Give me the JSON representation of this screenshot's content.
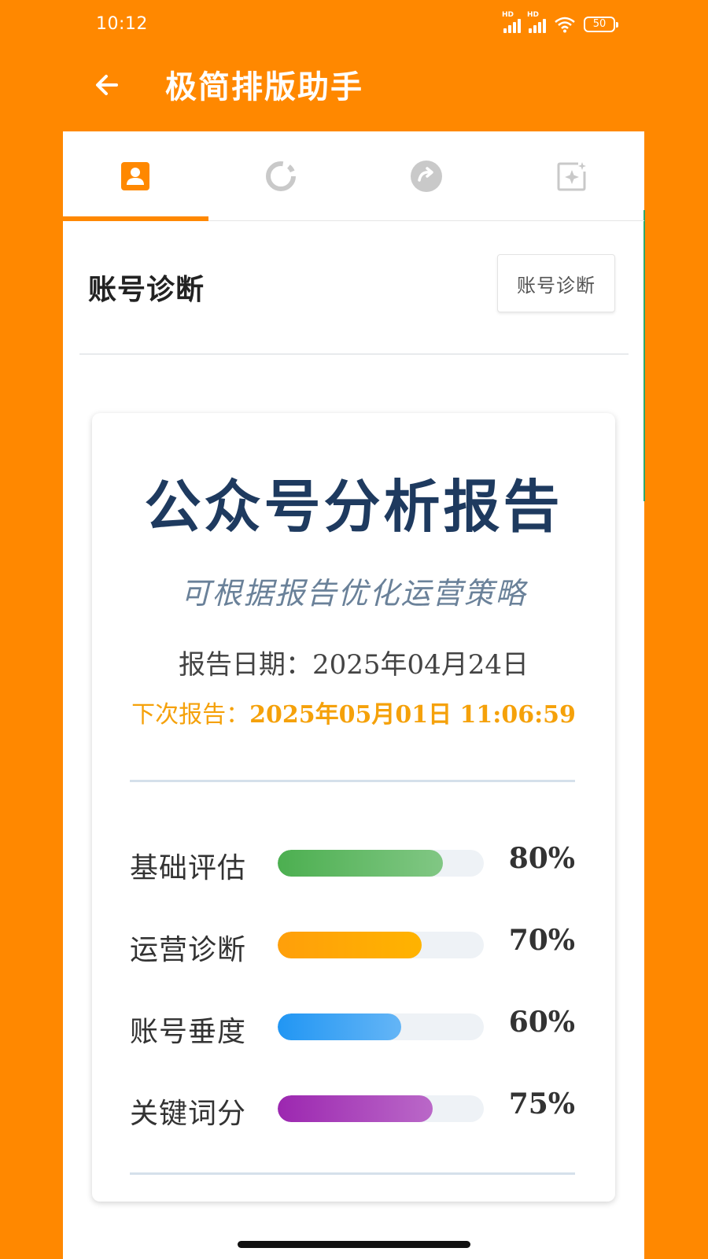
{
  "status_bar": {
    "time": "10:12",
    "signal_label": "HD",
    "battery": "50"
  },
  "app_bar": {
    "title": "极简排版助手",
    "back_icon": "arrow-left-icon"
  },
  "tabs": [
    {
      "icon": "user-card-icon",
      "active": true
    },
    {
      "icon": "loading-ring-icon",
      "active": false
    },
    {
      "icon": "redo-circle-icon",
      "active": false
    },
    {
      "icon": "sparkle-image-icon",
      "active": false
    }
  ],
  "section": {
    "title": "账号诊断",
    "button_label": "账号诊断"
  },
  "report": {
    "title": "公众号分析报告",
    "subtitle": "可根据报告优化运营策略",
    "date_label": "报告日期：",
    "date_value": "2025年04月24日",
    "next_label": "下次报告：",
    "next_value": "2025年05月01日 11:06:59",
    "metrics": [
      {
        "label": "基础评估",
        "value": "80%",
        "percent": 80,
        "colors": [
          "#4CAF50",
          "#81C784"
        ]
      },
      {
        "label": "运营诊断",
        "value": "70%",
        "percent": 70,
        "colors": [
          "#FF9F0A",
          "#FFB300"
        ]
      },
      {
        "label": "账号垂度",
        "value": "60%",
        "percent": 60,
        "colors": [
          "#2196F3",
          "#64B5F6"
        ]
      },
      {
        "label": "关键词分",
        "value": "75%",
        "percent": 75,
        "colors": [
          "#9C27B0",
          "#BA68C8"
        ]
      }
    ]
  },
  "colors": {
    "brand": "#FF8800",
    "title": "#1E3A5F",
    "subtitle": "#6A8199",
    "next_report": "#F5A10A"
  }
}
